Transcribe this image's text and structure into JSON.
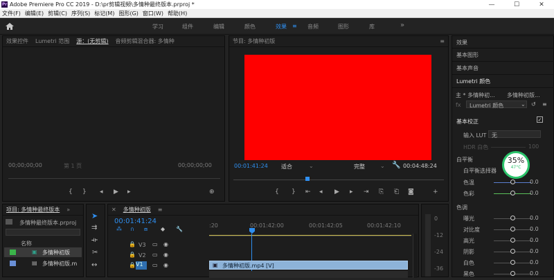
{
  "titlebar": {
    "logo": "Pr",
    "title": "Adobe Premiere Pro CC 2019 - D:\\pr剪辑视频\\多情种最终版本.prproj *",
    "min": "—",
    "max": "☐",
    "close": "✕"
  },
  "menu": [
    "文件(F)",
    "编辑(E)",
    "剪辑(C)",
    "序列(S)",
    "标记(M)",
    "图形(G)",
    "窗口(W)",
    "帮助(H)"
  ],
  "workspaces": [
    "学习",
    "组件",
    "编辑",
    "颜色",
    "效果",
    "音频",
    "图形",
    "库"
  ],
  "workspace_menu_icon": "≡",
  "workspace_more": "»",
  "source_panel": {
    "tabs": [
      "效果控件",
      "Lumetri 范围",
      "源：(无剪辑)",
      "音频剪辑混合器: 多情种"
    ],
    "timecode_left": "00;00;00;00",
    "page": "第 1 页",
    "timecode_right": "00;00;00;00"
  },
  "program_panel": {
    "title": "节目: 多情种初版",
    "timecode": "00:01:41:24",
    "fit": "适合",
    "quality": "完整",
    "duration": "00:04:48:24",
    "accent": "#ff0000"
  },
  "project_panel": {
    "title": "项目: 多情种最终版本",
    "file": "多情种最终版本.prproj",
    "col_name": "名称",
    "items": [
      "多情种初版",
      "多情种初版.m"
    ]
  },
  "timeline": {
    "title": "多情种初版",
    "timecode": "00:01:41:24",
    "ruler": [
      ":20",
      "00:01:42:00",
      "00:01:42:05",
      "00:01:42:10"
    ],
    "tracks": [
      "V3",
      "V2",
      "V1"
    ],
    "clip": "多情种初版.mp4 [V]"
  },
  "meter": [
    "0",
    "-12",
    "-24",
    "-36"
  ],
  "right_panel": {
    "sections": [
      "效果",
      "基本图形",
      "基本声音",
      "Lumetri 颜色"
    ],
    "master": "主 * 多情种初...",
    "clip_link": "多情种初版...",
    "fx_label": "fx",
    "fx_name": "Lumetri 颜色",
    "basic": "基本校正",
    "input_lut": "输入 LUT",
    "lut_value": "无",
    "hdr": "HDR 白色",
    "hdr_value": "100",
    "wb": "白平衡",
    "wb_picker": "白平衡选择器",
    "temp": "色温",
    "temp_value": "0.0",
    "tint": "色彩",
    "tint_value": "0.0",
    "tone": "色调",
    "tone_rows": [
      {
        "label": "曝光",
        "value": "0.0"
      },
      {
        "label": "对比度",
        "value": "0.0"
      },
      {
        "label": "高光",
        "value": "0.0"
      },
      {
        "label": "阴影",
        "value": "0.0"
      },
      {
        "label": "白色",
        "value": "0.0"
      },
      {
        "label": "黑色",
        "value": "0.0"
      }
    ],
    "badge_pct": "35%",
    "badge_temp": "47°C",
    "badge_color": "#2cc36b"
  }
}
